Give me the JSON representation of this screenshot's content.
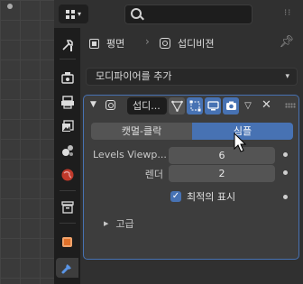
{
  "header": {
    "editor_type_icon": "properties-editor-icon",
    "search_placeholder": ""
  },
  "tabs": [
    {
      "name": "tool-icon",
      "active": false
    },
    {
      "name": "render-icon",
      "active": false
    },
    {
      "name": "output-icon",
      "active": false
    },
    {
      "name": "view-layer-icon",
      "active": false
    },
    {
      "name": "scene-icon",
      "active": false
    },
    {
      "name": "world-icon",
      "active": false
    },
    {
      "name": "collection-icon",
      "active": false
    },
    {
      "name": "object-icon",
      "active": false
    },
    {
      "name": "modifier-wrench-icon",
      "active": true
    }
  ],
  "breadcrumb": {
    "object_name": "평면",
    "modifier_name": "섭디비젼"
  },
  "add_modifier_label": "모디파이어를 추가",
  "modifier": {
    "name": "섭디...",
    "segments": {
      "catmull_label": "캣멀-클락",
      "simple_label": "심플",
      "selected": "심플"
    },
    "levels_viewport_label": "Levels Viewp...",
    "levels_viewport_value": "6",
    "render_label": "렌더",
    "render_value": "2",
    "optimal_display_label": "최적의 표시",
    "optimal_display_checked": true,
    "advanced_label": "고급"
  },
  "colors": {
    "accent": "#4772b3",
    "panel_bg": "#3d3d3d",
    "editor_bg": "#303030"
  }
}
